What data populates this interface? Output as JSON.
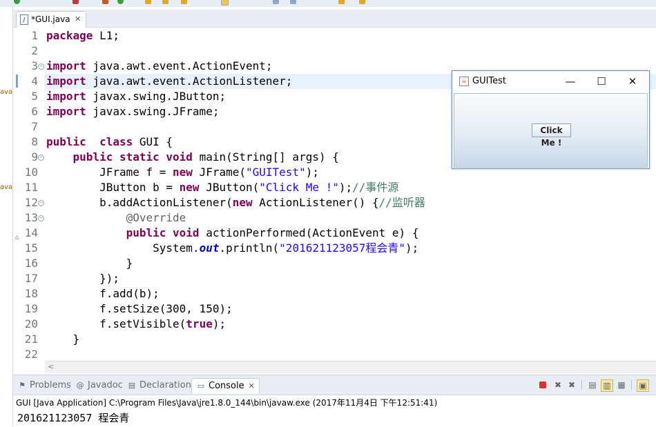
{
  "left_strip": [
    "ava",
    "ava"
  ],
  "editor_tab": {
    "title": "*GUI.java",
    "close": "✕",
    "icon": "J"
  },
  "code": {
    "lines": [
      {
        "n": "1",
        "fold": "",
        "html": "<span class=\"kw\">package</span> L1;"
      },
      {
        "n": "2",
        "fold": "",
        "html": ""
      },
      {
        "n": "3",
        "fold": "⊖",
        "html": "<span class=\"kw\">import</span> java.awt.event.ActionEvent;"
      },
      {
        "n": "4",
        "fold": "",
        "html": "<span class=\"kw\">import</span> java.awt.event.ActionListener;"
      },
      {
        "n": "5",
        "fold": "",
        "html": "<span class=\"kw\">import</span> javax.swing.JButton;"
      },
      {
        "n": "6",
        "fold": "",
        "html": "<span class=\"kw\">import</span> javax.swing.JFrame;"
      },
      {
        "n": "7",
        "fold": "",
        "html": ""
      },
      {
        "n": "8",
        "fold": "",
        "html": "<span class=\"kw\">public</span>  <span class=\"kw\">class</span> GUI {"
      },
      {
        "n": "9",
        "fold": "⊖",
        "html": "    <span class=\"kw\">public</span> <span class=\"kw\">static</span> <span class=\"kw\">void</span> main(String[] args) {"
      },
      {
        "n": "10",
        "fold": "",
        "html": "        JFrame f = <span class=\"kw\">new</span> JFrame(<span class=\"str\">\"GUITest\"</span>);"
      },
      {
        "n": "11",
        "fold": "",
        "html": "        JButton b = <span class=\"kw\">new</span> JButton(<span class=\"str\">\"Click Me !\"</span>);<span class=\"cm\">//事件源</span>"
      },
      {
        "n": "12",
        "fold": "⊖",
        "html": "        b.addActionListener(<span class=\"kw\">new</span> ActionListener() {<span class=\"cm\">//监听器</span>"
      },
      {
        "n": "13",
        "fold": "⊖",
        "html": "            <span class=\"an\">@Override</span>"
      },
      {
        "n": "14",
        "fold": "",
        "ov": "△",
        "html": "            <span class=\"kw\">public</span> <span class=\"kw\">void</span> actionPerformed(ActionEvent e) {"
      },
      {
        "n": "15",
        "fold": "",
        "html": "                System.<span class=\"fld\">out</span>.println(<span class=\"str\">\"201621123057程会青\"</span>);"
      },
      {
        "n": "16",
        "fold": "",
        "html": "            }"
      },
      {
        "n": "17",
        "fold": "",
        "html": "        });"
      },
      {
        "n": "18",
        "fold": "",
        "html": "        f.add(b);"
      },
      {
        "n": "19",
        "fold": "",
        "html": "        f.setSize(300, 150);"
      },
      {
        "n": "20",
        "fold": "",
        "html": "        f.setVisible(<span class=\"kw\">true</span>);"
      },
      {
        "n": "21",
        "fold": "",
        "html": "    }"
      },
      {
        "n": "22",
        "fold": "",
        "html": ""
      }
    ]
  },
  "hscroll_arrow": "<",
  "bottom_tabs": [
    {
      "label": "Problems",
      "icon": "⚑"
    },
    {
      "label": "Javadoc",
      "icon": "@"
    },
    {
      "label": "Declaration",
      "icon": "▤"
    },
    {
      "label": "Console",
      "icon": "▭",
      "close": "✕"
    }
  ],
  "console": {
    "launch": "GUI [Java Application] C:\\Program Files\\Java\\jre1.8.0_144\\bin\\javaw.exe (2017年11月4日 下午12:51:41)",
    "output": "201621123057 程会青"
  },
  "swing_window": {
    "title": "GUITest",
    "minimize": "—",
    "maximize": "☐",
    "close": "✕",
    "button_label": "Click Me !"
  },
  "colors": {
    "keyword": "#7f0055",
    "string": "#2a00ff",
    "comment": "#3f7f5f",
    "current_line": "#e8f2fe"
  }
}
